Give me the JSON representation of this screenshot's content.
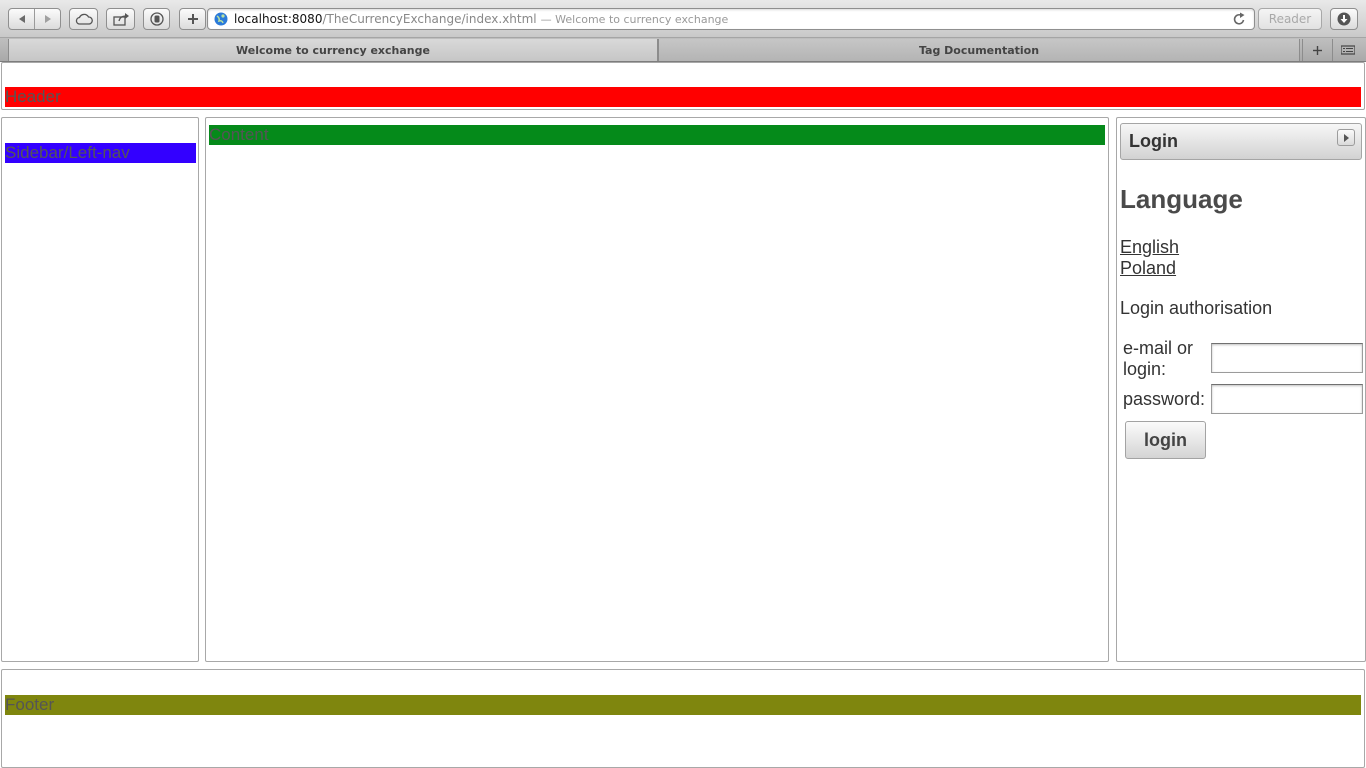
{
  "browser": {
    "url_host": "localhost:8080",
    "url_path": "/TheCurrencyExchange/index.xhtml",
    "url_title": "— Welcome to currency exchange",
    "reader_label": "Reader",
    "tabs": [
      {
        "label": "Welcome to currency exchange",
        "active": true
      },
      {
        "label": "Tag Documentation",
        "active": false
      }
    ]
  },
  "page": {
    "header": {
      "label": "Header",
      "color": "#ff0000"
    },
    "sidebar": {
      "label": "Sidebar/Left-nav",
      "color": "#3300ff"
    },
    "content": {
      "label": "Content",
      "color": "#058a1a"
    },
    "footer": {
      "label": "Footer",
      "color": "#7f860e"
    },
    "right_panel": {
      "panel_title": "Login",
      "language_heading": "Language",
      "languages": [
        "English",
        "Poland"
      ],
      "auth_title": "Login authorisation",
      "email_label": "e-mail or login:",
      "email_value": "",
      "password_label": "password:",
      "password_value": "",
      "login_button": "login"
    }
  }
}
